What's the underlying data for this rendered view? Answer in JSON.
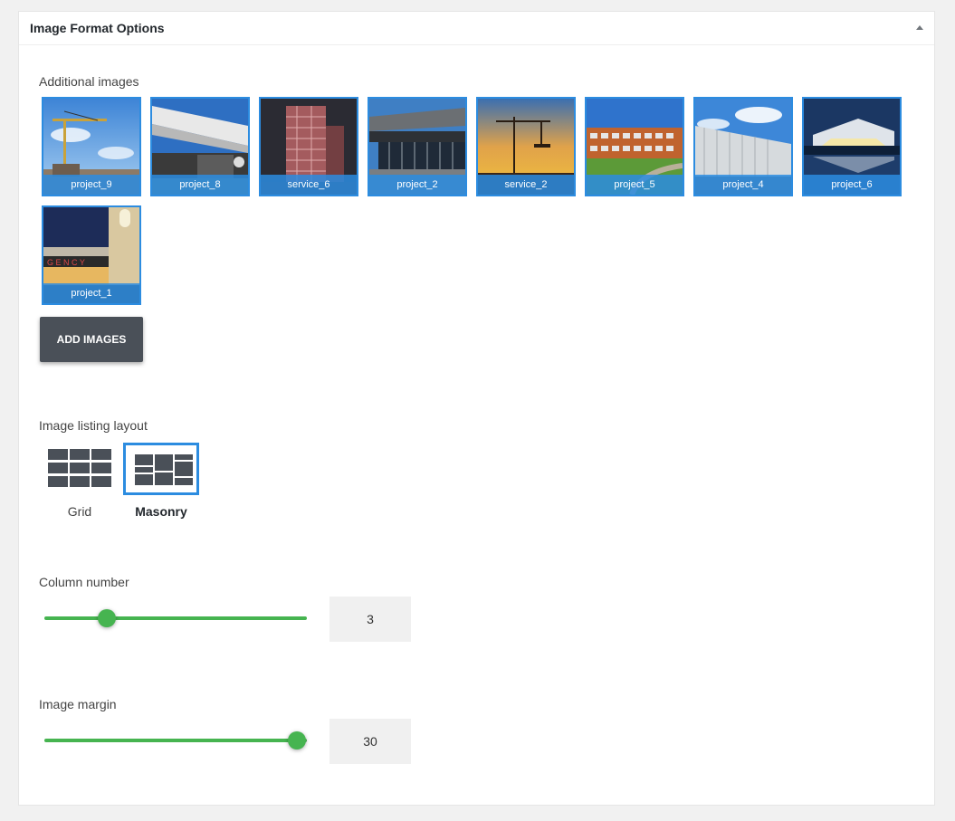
{
  "panel": {
    "title": "Image Format Options"
  },
  "additional_images": {
    "label": "Additional images",
    "images": [
      {
        "caption": "project_9"
      },
      {
        "caption": "project_8"
      },
      {
        "caption": "service_6"
      },
      {
        "caption": "project_2"
      },
      {
        "caption": "service_2"
      },
      {
        "caption": "project_5"
      },
      {
        "caption": "project_4"
      },
      {
        "caption": "project_6"
      },
      {
        "caption": "project_1"
      }
    ],
    "add_button_label": "ADD IMAGES"
  },
  "layout": {
    "label": "Image listing layout",
    "options": [
      {
        "name": "Grid",
        "selected": false
      },
      {
        "name": "Masonry",
        "selected": true
      }
    ]
  },
  "column_number": {
    "label": "Column number",
    "value": "3",
    "slider_fraction": 0.24
  },
  "image_margin": {
    "label": "Image margin",
    "value": "30",
    "slider_fraction": 1.0
  },
  "colors": {
    "accent": "#2c8ce0",
    "slider": "#46b450",
    "button": "#4a5058"
  }
}
